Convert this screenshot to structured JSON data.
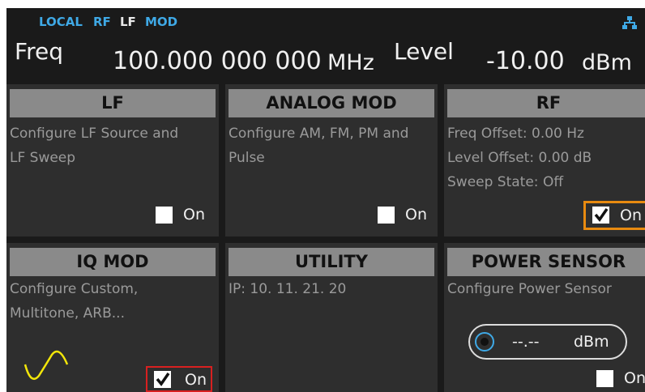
{
  "status_bar": {
    "local": "LOCAL",
    "rf": "RF",
    "lf": "LF",
    "mod": "MOD",
    "network_icon": "network-icon"
  },
  "header": {
    "freq_label": "Freq",
    "freq_value": "100.000 000 000",
    "freq_unit": "MHz",
    "level_label": "Level",
    "level_value": "-10.00",
    "level_unit": "dBm"
  },
  "tiles": {
    "lf": {
      "title": "LF",
      "lines": [
        "Configure LF Source and",
        "LF Sweep"
      ],
      "on_label": "On",
      "checked": false
    },
    "analog_mod": {
      "title": "ANALOG MOD",
      "lines": [
        "Configure AM, FM, PM and",
        "Pulse"
      ],
      "on_label": "On",
      "checked": false
    },
    "rf": {
      "title": "RF",
      "lines": [
        "Freq Offset: 0.00 Hz",
        "Level Offset: 0.00 dB",
        "Sweep State: Off"
      ],
      "on_label": "On",
      "checked": true
    },
    "iq_mod": {
      "title": "IQ MOD",
      "lines": [
        "Configure Custom,",
        "Multitone, ARB..."
      ],
      "on_label": "On",
      "checked": true,
      "icon": "sine-wave-icon"
    },
    "utility": {
      "title": "UTILITY",
      "lines": [
        "IP:  10. 11. 21. 20"
      ]
    },
    "power_sensor": {
      "title": "POWER SENSOR",
      "lines": [
        "Configure Power Sensor"
      ],
      "reading": "--.--",
      "reading_unit": "dBm",
      "on_label": "On",
      "checked": false
    }
  },
  "colors": {
    "background": "#1a1a1a",
    "tile": "#2e2e2e",
    "tile_header": "#8a8a8a",
    "accent_blue": "#3fa9e6",
    "highlight_red": "#d82020",
    "highlight_orange": "#e88a10",
    "sine_yellow": "#f2e60a"
  }
}
